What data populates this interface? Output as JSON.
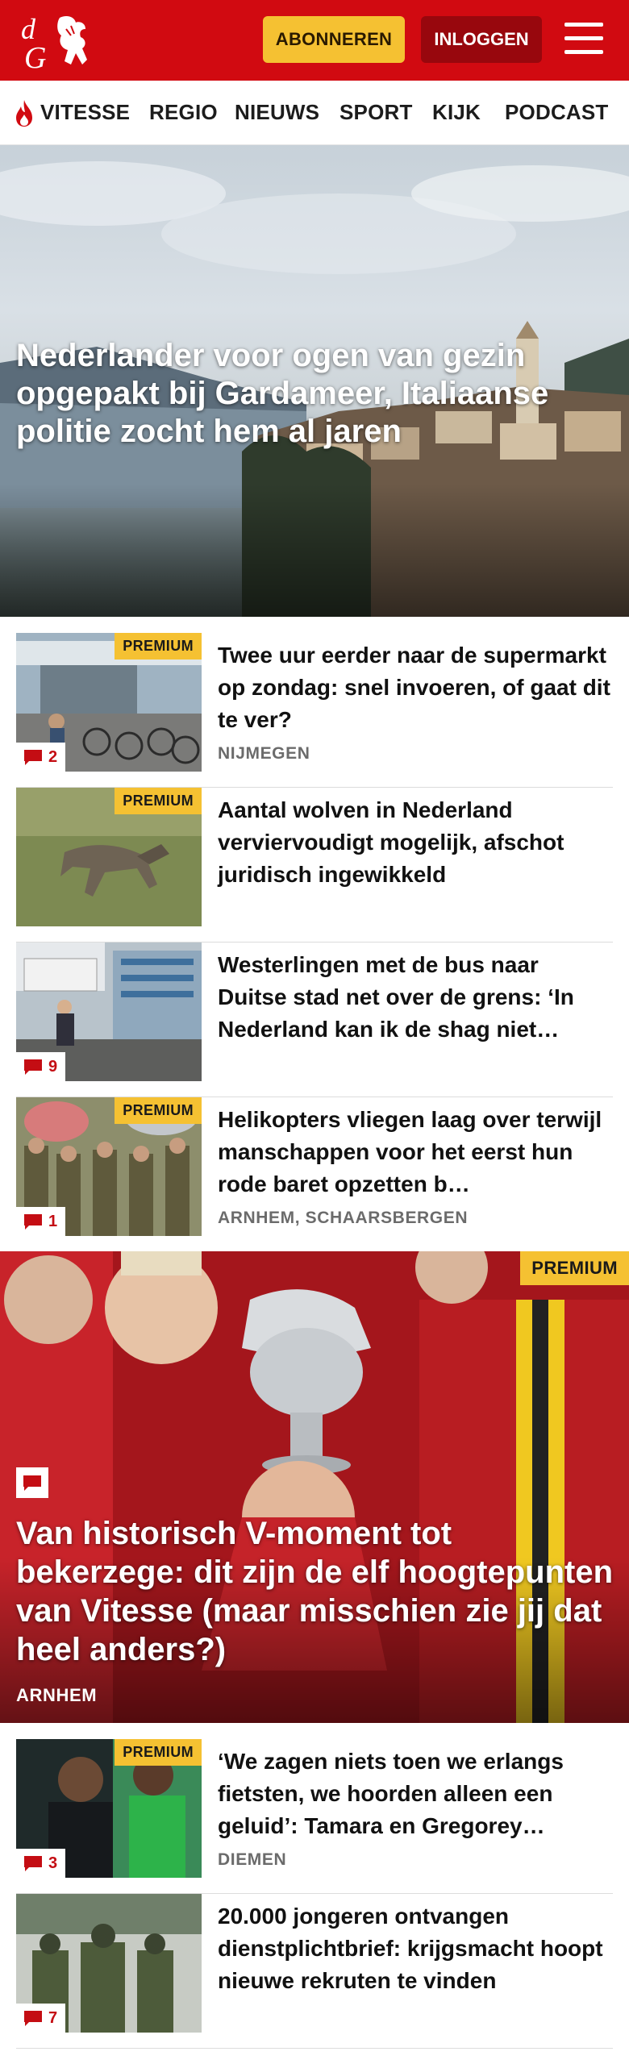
{
  "header": {
    "subscribe_label": "ABONNEREN",
    "login_label": "INLOGGEN",
    "brand_color": "#d10a11"
  },
  "nav": {
    "items": [
      {
        "label": "VITESSE",
        "icon": "flame-icon"
      },
      {
        "label": "REGIO"
      },
      {
        "label": "NIEUWS"
      },
      {
        "label": "SPORT"
      },
      {
        "label": "KIJK"
      },
      {
        "label": "PODCAST"
      }
    ]
  },
  "hero": {
    "title": "Nederlander voor ogen van gezin opgepakt bij Gardameer, Italiaanse politie zocht hem al jaren"
  },
  "articles": [
    {
      "title": "Twee uur eerder naar de supermarkt op zondag: snel invoeren, of gaat dit te ver?",
      "location": "NIJMEGEN",
      "premium": "PREMIUM",
      "comments": "2"
    },
    {
      "title": "Aantal wolven in Nederland verviervoudigt mogelijk, afschot juridisch ingewikkeld",
      "location": "",
      "premium": "PREMIUM",
      "comments": ""
    },
    {
      "title": "Westerlingen met de bus naar Duitse stad net over de grens: ‘In Nederland kan ik de shag niet…",
      "location": "",
      "premium": "",
      "comments": "9"
    },
    {
      "title": "Helikopters vliegen laag over terwijl manschappen voor het eerst hun rode baret opzetten b…",
      "location": "ARNHEM, SCHAARSBERGEN",
      "premium": "PREMIUM",
      "comments": "1"
    }
  ],
  "feature": {
    "title": "Van historisch V-moment tot bekerzege: dit zijn de elf hoogtepun­ten van Vitesse (maar misschien zie jij dat heel anders?)",
    "location": "ARNHEM",
    "premium": "PREMIUM"
  },
  "articles2": [
    {
      "title": "‘We zagen niets toen we erlangs fietsten, we hoorden alleen een geluid’: Tamara en Gregorey…",
      "location": "DIEMEN",
      "premium": "PREMIUM",
      "comments": "3"
    },
    {
      "title": "20.000 jongeren ontvangen dienstplichtbrief: krijgsmacht hoopt nieuwe rekruten te vinden",
      "location": "",
      "premium": "",
      "comments": "7"
    }
  ]
}
